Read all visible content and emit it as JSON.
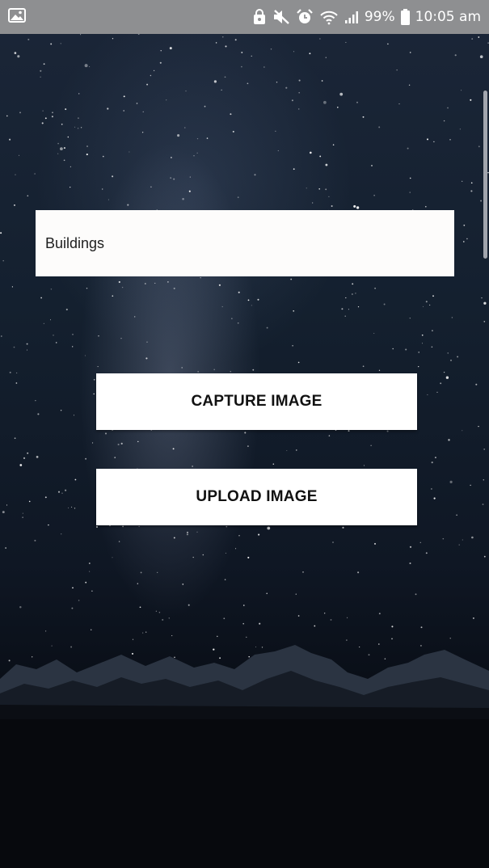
{
  "status_bar": {
    "battery": "99%",
    "time": "10:05 am",
    "icons": [
      "gallery-icon",
      "alarm-lock-icon",
      "mute-icon",
      "alarm-clock-icon",
      "wifi-icon",
      "signal-icon",
      "battery-icon"
    ]
  },
  "form": {
    "text_value": "Buildings"
  },
  "buttons": {
    "capture_label": "CAPTURE IMAGE",
    "upload_label": "UPLOAD IMAGE"
  },
  "colors": {
    "status_bar": "#8e8f91",
    "button_bg": "#ffffff",
    "button_text": "#111111",
    "sky_top": "#1b2638",
    "ground": "#05070b"
  }
}
